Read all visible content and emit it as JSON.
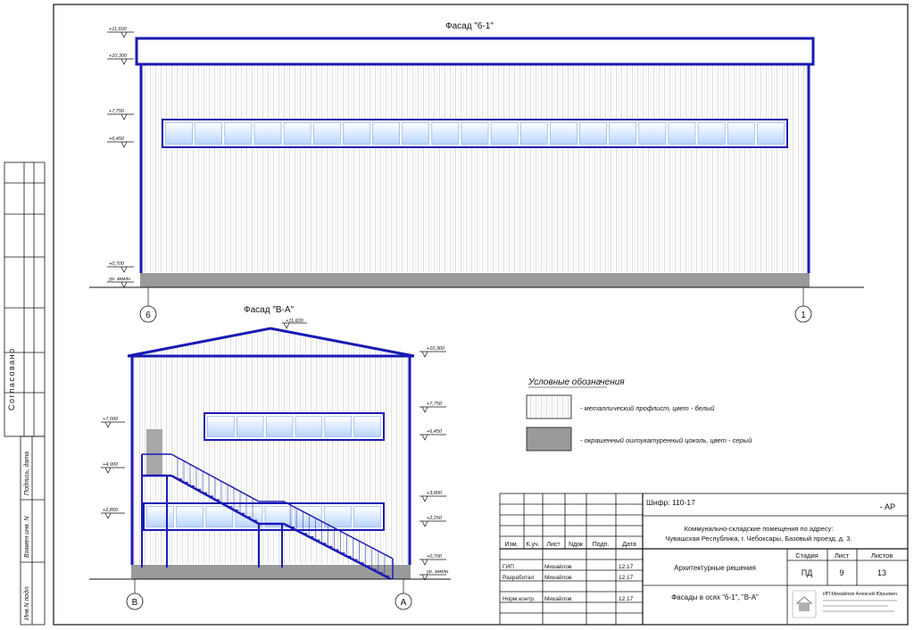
{
  "colors": {
    "structure": "#1a1ab4",
    "window": "#cfe3ff",
    "plinth": "#9a9a9a",
    "cladding_line": "#d8d8d8",
    "ink": "#111111"
  },
  "facade_top": {
    "title": "Фасад \"6-1\"",
    "levels": [
      "+11,600",
      "+10,300",
      "+7,750",
      "+6,450",
      "+0,700",
      "ур. земли"
    ],
    "axis_left": "6",
    "axis_right": "1"
  },
  "facade_side": {
    "title": "Фасад \"В-А\"",
    "ridge_level": "+11,600",
    "levels_left": [
      "+7,000",
      "+4,900",
      "+2,850"
    ],
    "levels_right": [
      "+10,300",
      "+7,750",
      "+6,450",
      "+3,800",
      "+2,250",
      "+0,700",
      "ур. земли"
    ],
    "axis_left": "В",
    "axis_right": "А"
  },
  "legend": {
    "title": "Условные обозначения",
    "items": [
      "- металлический профлист, цвет - белый",
      "- окрашенный оштукатуренный цоколь, цвет - серый"
    ]
  },
  "side_stamp": {
    "agreed": "Согласовано",
    "sign_date": "Подпись, дата",
    "replace_inv": "Взамен инв. N",
    "orig_inv": "Инв.N подл."
  },
  "title_block": {
    "code": "Шифр: 110-17",
    "section": "- АР",
    "object": [
      "Коммунально-складские помещения по адресу:",
      "Чувашская Республика, г. Чебоксары, Базовый проезд, д. 3."
    ],
    "headers": [
      "Изм.",
      "К.уч.",
      "Лист",
      "Nдок",
      "Подп.",
      "Дата"
    ],
    "rows": [
      {
        "role": "ГИП",
        "name": "Михайлов",
        "date": "12.17"
      },
      {
        "role": "Разработал",
        "name": "Михайлов",
        "date": "12.17"
      },
      {
        "role": "Норм.контр.",
        "name": "Михайлов",
        "date": "12.17"
      }
    ],
    "discipline": "Архитектурные решения",
    "sheet_title": "Фасады в осях \"6-1\", \"В-А\"",
    "stage_label": "Стадия",
    "sheet_label": "Лист",
    "sheets_label": "Листов",
    "stage": "ПД",
    "sheet": "9",
    "sheets": "13",
    "company": "ИП Михайлов Алексей Юрьевич"
  }
}
